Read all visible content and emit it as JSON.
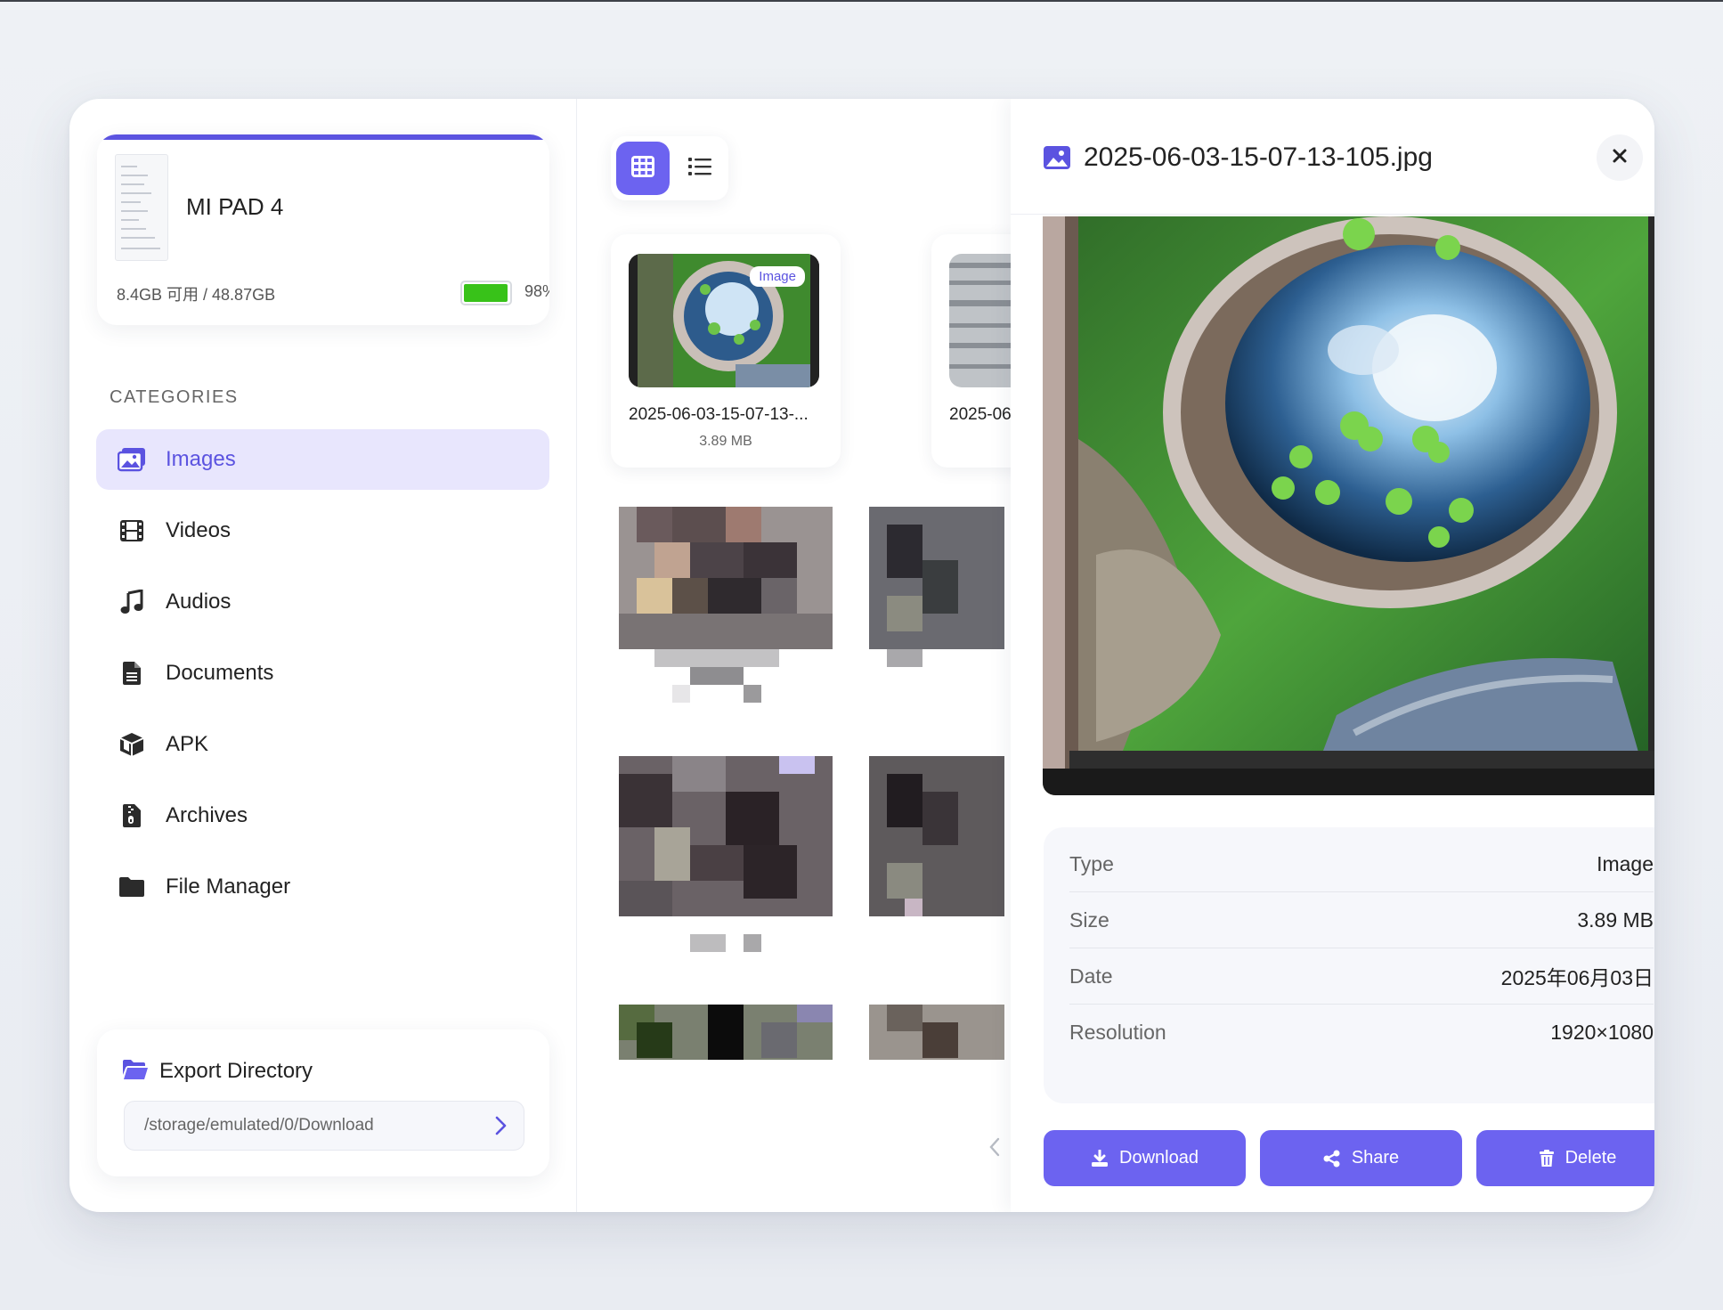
{
  "device": {
    "name": "MI PAD 4",
    "storage": "8.4GB 可用 / 48.87GB",
    "battery": "98%",
    "battery_level": 0.98
  },
  "sidebar": {
    "section_label": "CATEGORIES",
    "items": [
      {
        "label": "Images",
        "icon": "images-icon",
        "active": true
      },
      {
        "label": "Videos",
        "icon": "film-icon",
        "active": false
      },
      {
        "label": "Audios",
        "icon": "music-icon",
        "active": false
      },
      {
        "label": "Documents",
        "icon": "document-icon",
        "active": false
      },
      {
        "label": "APK",
        "icon": "package-icon",
        "active": false
      },
      {
        "label": "Archives",
        "icon": "archive-icon",
        "active": false
      },
      {
        "label": "File Manager",
        "icon": "folder-icon",
        "active": false
      }
    ]
  },
  "export": {
    "title": "Export Directory",
    "path": "/storage/emulated/0/Download"
  },
  "view_toggle": {
    "grid_icon": "grid-icon",
    "list_icon": "list-icon",
    "active": "grid"
  },
  "files": [
    {
      "name": "2025-06-03-15-07-13-...",
      "size": "3.89 MB",
      "badge": "Image"
    },
    {
      "name": "2025-06",
      "size": "",
      "badge": ""
    }
  ],
  "details": {
    "title": "2025-06-03-15-07-13-105.jpg",
    "rows": [
      {
        "key": "Type",
        "value": "Image"
      },
      {
        "key": "Size",
        "value": "3.89 MB"
      },
      {
        "key": "Date",
        "value": "2025年06月03日"
      },
      {
        "key": "Resolution",
        "value": "1920×1080"
      }
    ],
    "actions": [
      {
        "label": "Download",
        "icon": "download-icon"
      },
      {
        "label": "Share",
        "icon": "share-icon"
      },
      {
        "label": "Delete",
        "icon": "trash-icon"
      }
    ]
  },
  "colors": {
    "accent": "#6c63f0",
    "accent_light": "#e8e6fd",
    "battery": "#38c219"
  }
}
